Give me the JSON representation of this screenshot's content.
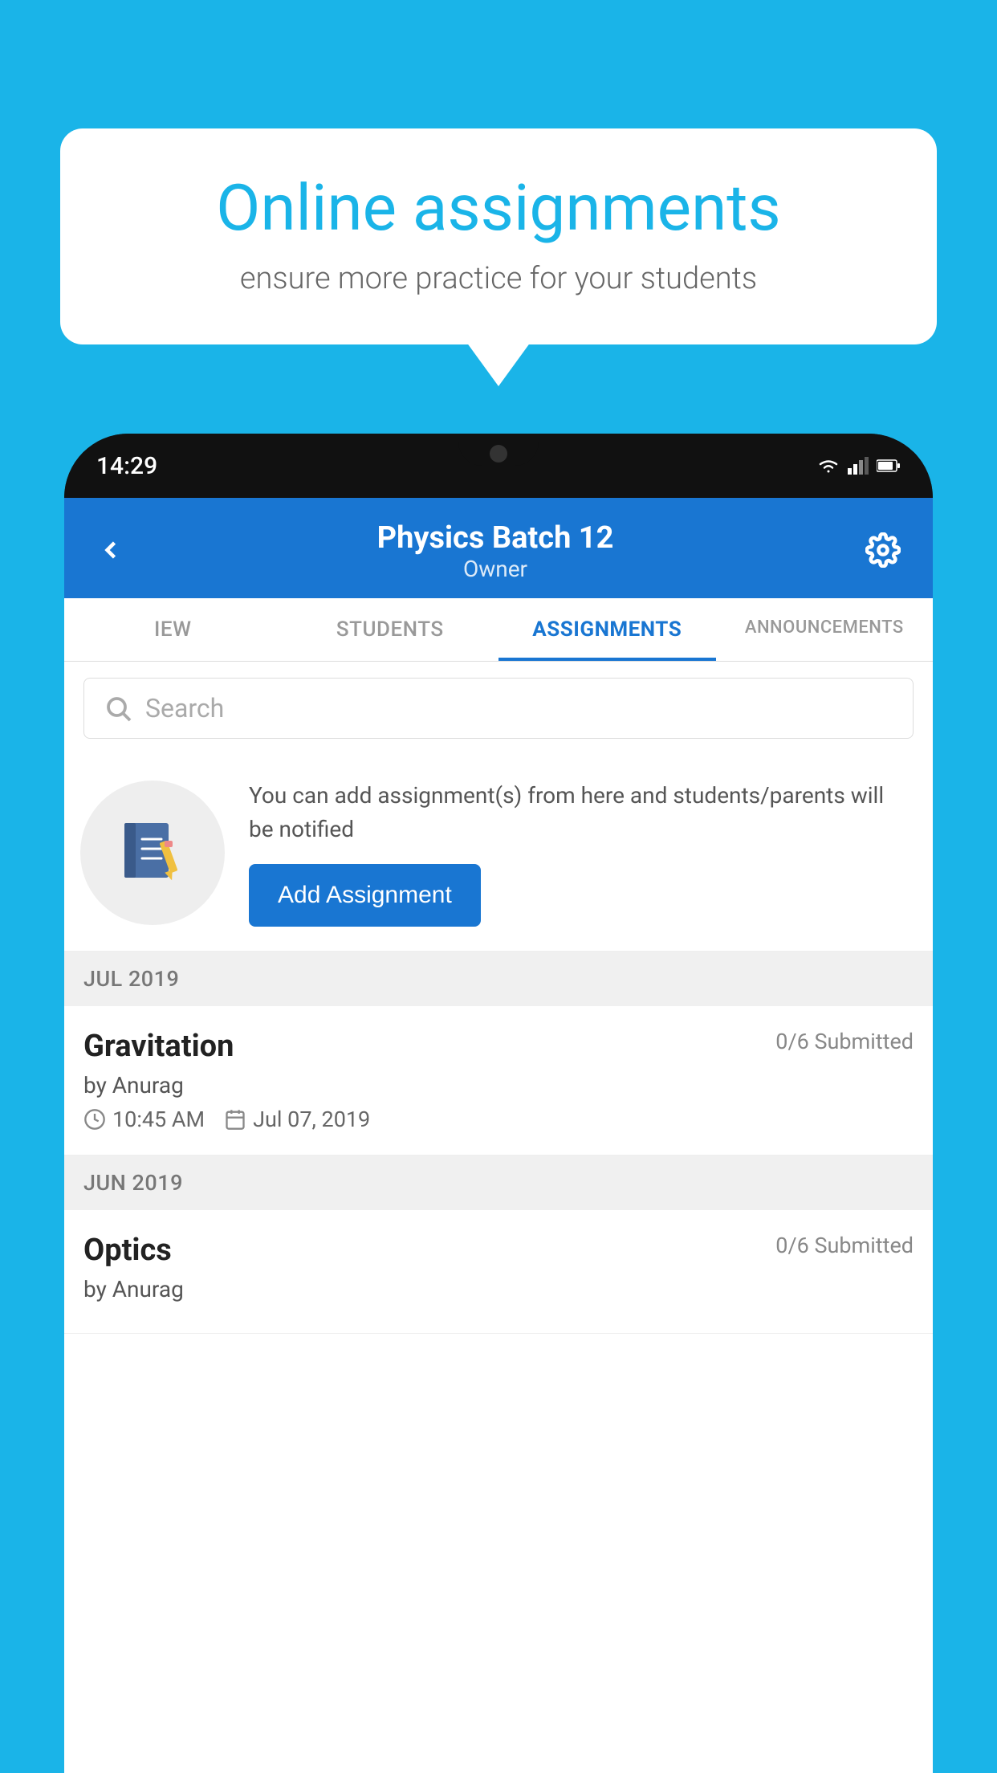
{
  "background_color": "#1ab4e8",
  "speech_bubble": {
    "title": "Online assignments",
    "subtitle": "ensure more practice for your students"
  },
  "phone": {
    "status_bar": {
      "time": "14:29"
    },
    "header": {
      "back_label": "←",
      "title": "Physics Batch 12",
      "subtitle": "Owner",
      "settings_label": "⚙"
    },
    "tabs": [
      {
        "label": "IEW",
        "active": false
      },
      {
        "label": "STUDENTS",
        "active": false
      },
      {
        "label": "ASSIGNMENTS",
        "active": true
      },
      {
        "label": "ANNOUNCEMENTS",
        "active": false
      }
    ],
    "search": {
      "placeholder": "Search"
    },
    "empty_state": {
      "description": "You can add assignment(s) from here and students/parents will be notified",
      "button_label": "Add Assignment"
    },
    "sections": [
      {
        "month_label": "JUL 2019",
        "assignments": [
          {
            "name": "Gravitation",
            "submitted": "0/6 Submitted",
            "by": "by Anurag",
            "time": "10:45 AM",
            "date": "Jul 07, 2019"
          }
        ]
      },
      {
        "month_label": "JUN 2019",
        "assignments": [
          {
            "name": "Optics",
            "submitted": "0/6 Submitted",
            "by": "by Anurag",
            "time": "",
            "date": ""
          }
        ]
      }
    ]
  }
}
